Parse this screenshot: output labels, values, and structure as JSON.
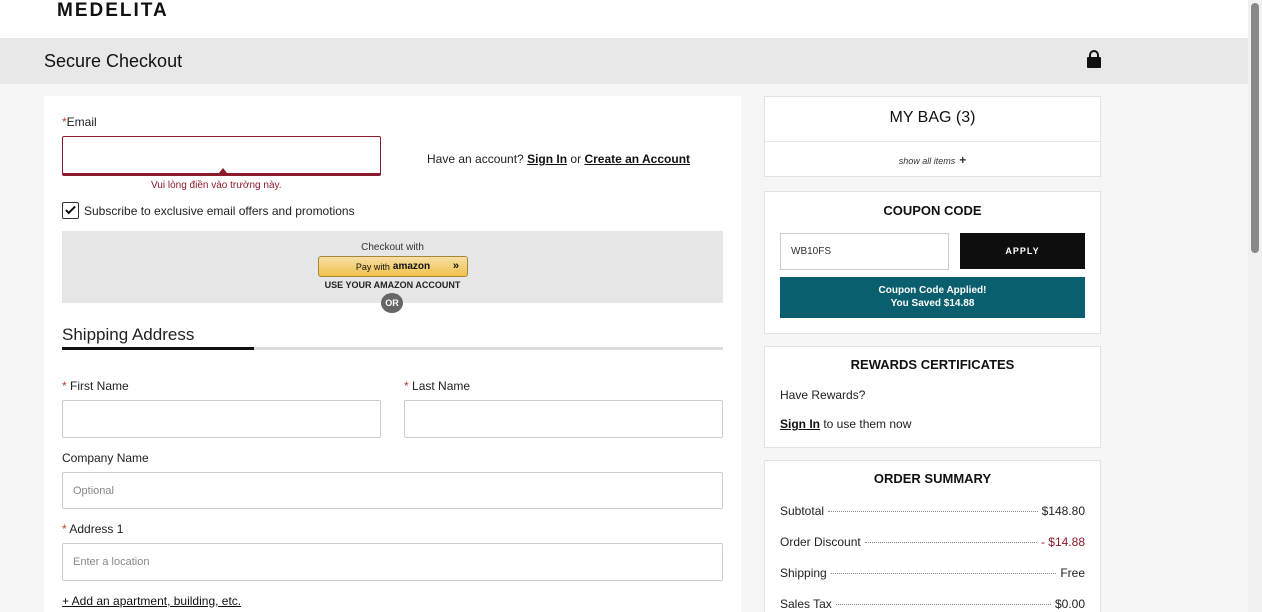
{
  "header": {
    "logo": "MEDELITA",
    "page_title": "Secure Checkout"
  },
  "email": {
    "label": "Email",
    "error": "Vui lòng điền vào trường này.",
    "account_prompt": "Have an account?",
    "sign_in": "Sign In",
    "or_text": "or",
    "create_account": "Create an Account",
    "subscribe_label": "Subscribe to exclusive email offers and promotions",
    "subscribe_checked": true
  },
  "amazon": {
    "checkout_with": "Checkout with",
    "pay_with": "Pay with",
    "brand": "amazon",
    "use_account": "USE YOUR AMAZON ACCOUNT",
    "or_label": "OR"
  },
  "shipping": {
    "title": "Shipping Address",
    "first_name_label": "First Name",
    "last_name_label": "Last Name",
    "company_label": "Company Name",
    "company_placeholder": "Optional",
    "address1_label": "Address 1",
    "address1_placeholder": "Enter a location",
    "add_apartment": "+ Add an apartment, building, etc."
  },
  "bag": {
    "title": "MY BAG (3)",
    "show_all": "show all items",
    "show_all_icon": "+"
  },
  "coupon": {
    "title": "COUPON CODE",
    "value": "WB10FS",
    "apply_label": "APPLY",
    "applied_line1": "Coupon Code Applied!",
    "applied_line2": "You Saved $14.88"
  },
  "rewards": {
    "title": "REWARDS CERTIFICATES",
    "have_rewards": "Have Rewards?",
    "sign_in": "Sign In",
    "use_them": "to use them now"
  },
  "summary": {
    "title": "ORDER SUMMARY",
    "rows": [
      {
        "label": "Subtotal",
        "value": "$148.80"
      },
      {
        "label": "Order Discount",
        "value": "- $14.88"
      },
      {
        "label": "Shipping",
        "value": "Free"
      },
      {
        "label": "Sales Tax",
        "value": "$0.00"
      }
    ]
  },
  "colors": {
    "accent_error": "#8b1a2b",
    "coupon_applied_bg": "#0a5f6e",
    "apply_button_bg": "#0e0e0e",
    "amazon_button": "#f0c14b"
  },
  "icons": {
    "lock": "lock-icon",
    "checkbox": "checkmark-icon",
    "amazon_chevron": "double-chevron-right-icon"
  }
}
